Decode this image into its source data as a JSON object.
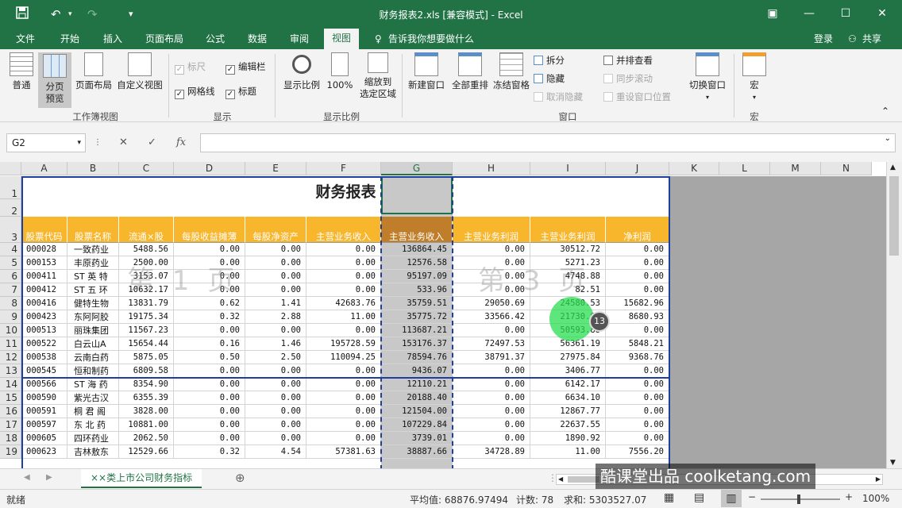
{
  "window": {
    "title": "财务报表2.xls  [兼容模式] - Excel"
  },
  "qat": {
    "save": "save-icon",
    "undo": "↶",
    "redo": "↷",
    "customize": "▾"
  },
  "tabs": [
    "文件",
    "开始",
    "插入",
    "页面布局",
    "公式",
    "数据",
    "审阅",
    "视图"
  ],
  "tell_me": "告诉我你想要做什么",
  "account": {
    "login": "登录",
    "share": "共享"
  },
  "ribbon": {
    "workbook_views": {
      "normal": "普通",
      "page_break": "分页\n预览",
      "page_layout": "页面布局",
      "custom": "自定义视图",
      "group": "工作簿视图"
    },
    "show": {
      "ruler": "标尺",
      "formula_bar": "编辑栏",
      "gridlines": "网格线",
      "headings": "标题",
      "group": "显示"
    },
    "zoom": {
      "zoom": "显示比例",
      "hundred": "100%",
      "to_sel": "缩放到\n选定区域",
      "group": "显示比例"
    },
    "window": {
      "new": "新建窗口",
      "arrange": "全部重排",
      "freeze": "冻结窗格",
      "split": "拆分",
      "hide": "隐藏",
      "unhide": "取消隐藏",
      "side": "并排查看",
      "sync": "同步滚动",
      "reset": "重设窗口位置",
      "switch": "切换窗口",
      "group": "窗口"
    },
    "macros": {
      "macro": "宏",
      "group": "宏"
    }
  },
  "formula_bar": {
    "name_box": "G2",
    "fx": "fx"
  },
  "columns": [
    "A",
    "B",
    "C",
    "D",
    "E",
    "F",
    "G",
    "H",
    "I",
    "J",
    "K",
    "L",
    "M",
    "N"
  ],
  "sheet": {
    "title": "财务报表",
    "headers": [
      "股票代码",
      "股票名称",
      "流通×股",
      "每股收益摊薄",
      "每股净资产",
      "主营业务收入",
      "主营业务收入",
      "主营业务利润",
      "主营业务利润",
      "净利润"
    ],
    "rows": [
      [
        "000028",
        "一致药业",
        "5488.56",
        "0.00",
        "0.00",
        "0.00",
        "136864.45",
        "0.00",
        "30512.72",
        "0.00"
      ],
      [
        "000153",
        "丰原药业",
        "2500.00",
        "0.00",
        "0.00",
        "0.00",
        "12576.58",
        "0.00",
        "5271.23",
        "0.00"
      ],
      [
        "000411",
        "ST 英 特",
        "3153.07",
        "0.00",
        "0.00",
        "0.00",
        "95197.09",
        "0.00",
        "4748.88",
        "0.00"
      ],
      [
        "000412",
        "ST 五 环",
        "10632.17",
        "0.00",
        "0.00",
        "0.00",
        "533.96",
        "0.00",
        "82.51",
        "0.00"
      ],
      [
        "000416",
        "健特生物",
        "13831.79",
        "0.62",
        "1.41",
        "42683.76",
        "35759.51",
        "29050.69",
        "24580.53",
        "15682.96"
      ],
      [
        "000423",
        "东阿阿胶",
        "19175.34",
        "0.32",
        "2.88",
        "11.00",
        "35775.72",
        "33566.42",
        "21730.99",
        "8680.93"
      ],
      [
        "000513",
        "丽珠集团",
        "11567.23",
        "0.00",
        "0.00",
        "0.00",
        "113687.21",
        "0.00",
        "50593.88",
        "0.00"
      ],
      [
        "000522",
        "白云山A",
        "15654.44",
        "0.16",
        "1.46",
        "195728.59",
        "153176.37",
        "72497.53",
        "56361.19",
        "5848.21"
      ],
      [
        "000538",
        "云南白药",
        "5875.05",
        "0.50",
        "2.50",
        "110094.25",
        "78594.76",
        "38791.37",
        "27975.84",
        "9368.76"
      ],
      [
        "000545",
        "恒和制药",
        "6809.58",
        "0.00",
        "0.00",
        "0.00",
        "9436.07",
        "0.00",
        "3406.77",
        "0.00"
      ],
      [
        "000566",
        "ST 海 药",
        "8354.90",
        "0.00",
        "0.00",
        "0.00",
        "12110.21",
        "0.00",
        "6142.17",
        "0.00"
      ],
      [
        "000590",
        "紫光古汉",
        "6355.39",
        "0.00",
        "0.00",
        "0.00",
        "20188.40",
        "0.00",
        "6634.10",
        "0.00"
      ],
      [
        "000591",
        "桐 君 阁",
        "3828.00",
        "0.00",
        "0.00",
        "0.00",
        "121504.00",
        "0.00",
        "12867.77",
        "0.00"
      ],
      [
        "000597",
        "东 北 药",
        "10881.00",
        "0.00",
        "0.00",
        "0.00",
        "107229.84",
        "0.00",
        "22637.55",
        "0.00"
      ],
      [
        "000605",
        "四环药业",
        "2062.50",
        "0.00",
        "0.00",
        "0.00",
        "3739.01",
        "0.00",
        "1890.92",
        "0.00"
      ],
      [
        "000623",
        "吉林敖东",
        "12529.66",
        "0.32",
        "4.54",
        "57381.63",
        "38887.66",
        "34728.89",
        "11.00",
        "7556.20"
      ]
    ],
    "row_numbers": [
      "1",
      "2",
      "3",
      "4",
      "5",
      "6",
      "7",
      "8",
      "9",
      "10",
      "11",
      "12",
      "13",
      "14",
      "15",
      "16",
      "17",
      "18",
      "19"
    ],
    "page_marks": [
      "第 1 页",
      "第 3 页"
    ]
  },
  "sheet_tab": "××类上市公司财务指标",
  "badge": "13",
  "status": {
    "ready": "就绪",
    "average": "平均值: 68876.97494",
    "count": "计数: 78",
    "sum": "求和: 5303527.07",
    "zoom": "100%"
  },
  "watermark": "酷课堂出品 coolketang.com",
  "colors": {
    "excel_green": "#217346",
    "header_orange": "#f8b62d",
    "header_selected": "#c17e2a",
    "page_border": "#1f3fa0",
    "selected_col": "#c8c8c8"
  }
}
